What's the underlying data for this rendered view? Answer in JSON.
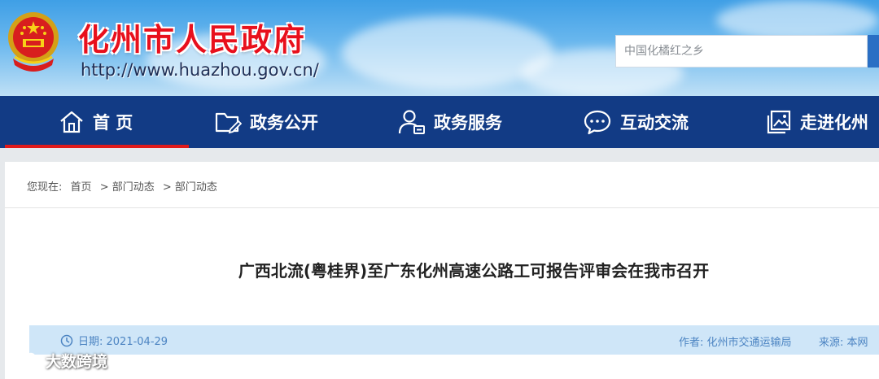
{
  "header": {
    "site_title": "化州市人民政府",
    "site_url": "http://www.huazhou.gov.cn/",
    "search_placeholder": "中国化橘红之乡"
  },
  "nav": {
    "items": [
      {
        "label": "首 页",
        "icon": "home-icon",
        "active": true
      },
      {
        "label": "政务公开",
        "icon": "folder-icon",
        "active": false
      },
      {
        "label": "政务服务",
        "icon": "user-service-icon",
        "active": false
      },
      {
        "label": "互动交流",
        "icon": "chat-icon",
        "active": false
      },
      {
        "label": "走进化州",
        "icon": "gallery-icon",
        "active": false
      }
    ]
  },
  "breadcrumb": {
    "prefix": "您现在:",
    "items": [
      "首页",
      "> 部门动态",
      "> 部门动态"
    ]
  },
  "article": {
    "title": "广西北流(粤桂界)至广东化州高速公路工可报告评审会在我市召开",
    "date": "日期: 2021-04-29",
    "author": "作者: 化州市交通运输局",
    "source": "来源: 本网"
  },
  "watermark": {
    "text": "大数跨境"
  },
  "colors": {
    "nav_bg": "#123b85",
    "active_bar": "#e11a1a",
    "title_red": "#e8101c",
    "meta_bg": "#cfe6f8"
  }
}
